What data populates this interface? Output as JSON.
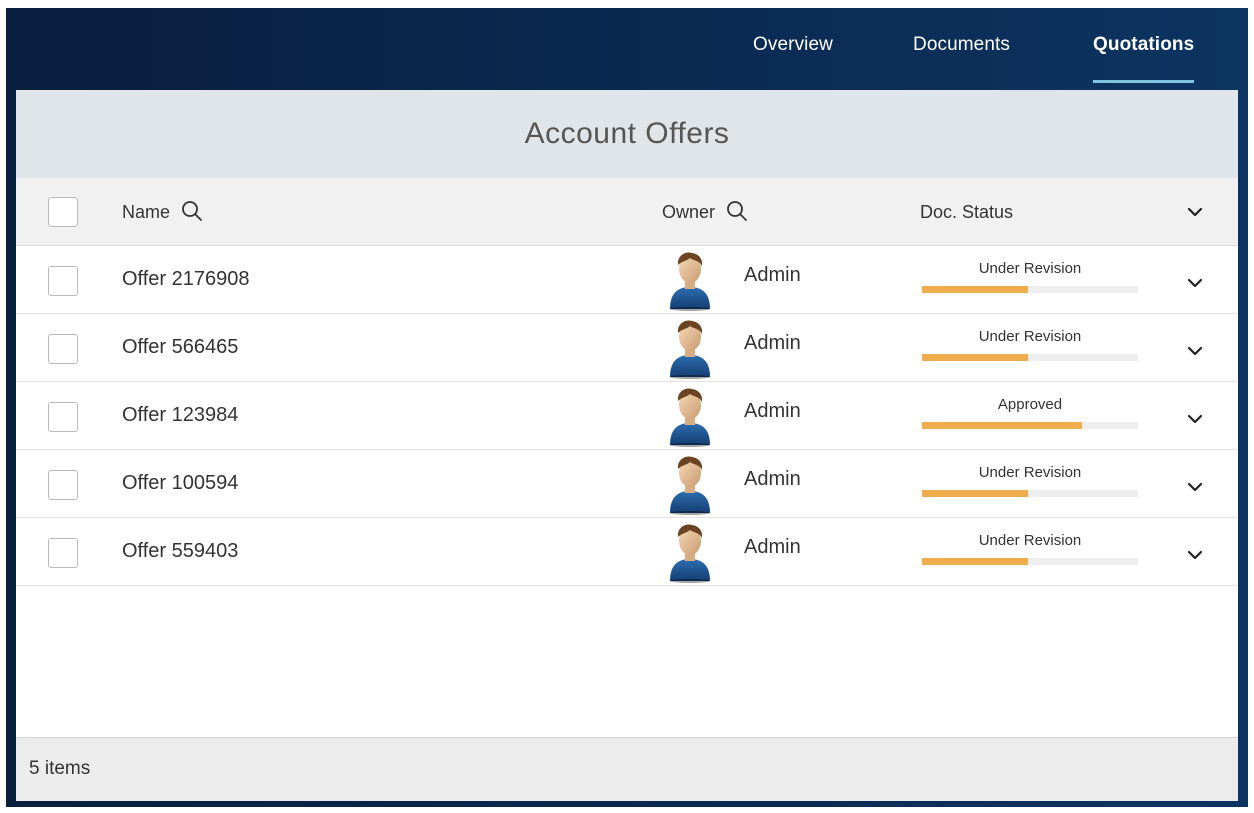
{
  "nav": {
    "tabs": [
      {
        "label": "Overview",
        "active": false
      },
      {
        "label": "Documents",
        "active": false
      },
      {
        "label": "Quotations",
        "active": true
      }
    ]
  },
  "panel": {
    "title": "Account Offers",
    "columns": {
      "name": "Name",
      "owner": "Owner",
      "status": "Doc. Status"
    },
    "rows": [
      {
        "name": "Offer 2176908",
        "owner": "Admin",
        "status": "Under Revision",
        "progress": 0.49
      },
      {
        "name": "Offer 566465",
        "owner": "Admin",
        "status": "Under Revision",
        "progress": 0.49
      },
      {
        "name": "Offer 123984",
        "owner": "Admin",
        "status": "Approved",
        "progress": 0.74
      },
      {
        "name": "Offer 100594",
        "owner": "Admin",
        "status": "Under Revision",
        "progress": 0.49
      },
      {
        "name": "Offer 559403",
        "owner": "Admin",
        "status": "Under Revision",
        "progress": 0.49
      }
    ],
    "footer_count": "5 items"
  },
  "colors": {
    "nav_bg": "#0b2a52",
    "tab_underline": "#7fc4e0",
    "progress_fill": "#f0ad4e",
    "title_bar": "#dfe5e9"
  },
  "icons": {
    "search": "search-icon",
    "expand": "chevron-down-icon",
    "avatar": "user-avatar-icon"
  }
}
